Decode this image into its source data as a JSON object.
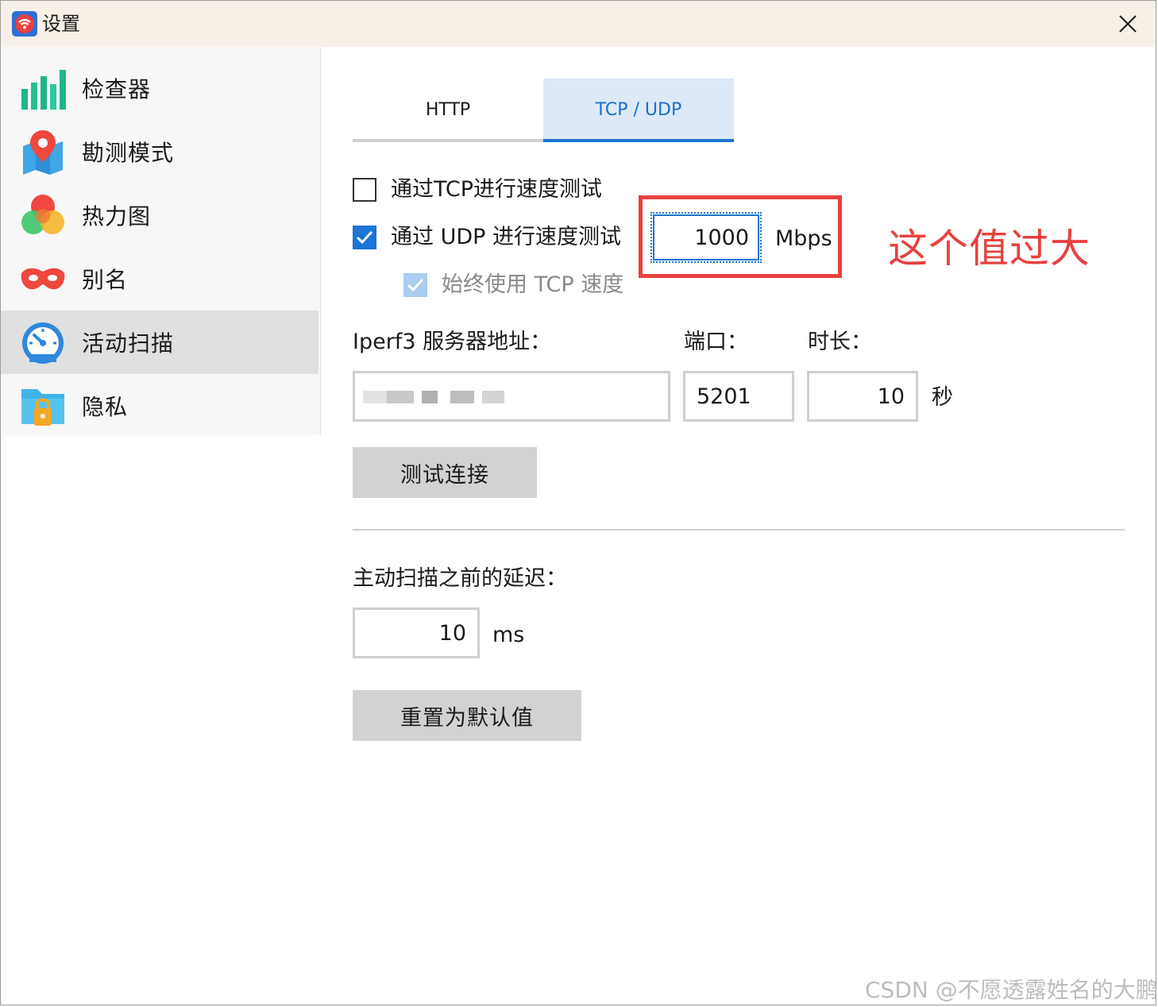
{
  "window": {
    "title": "设置"
  },
  "sidebar": {
    "items": [
      {
        "label": "检查器",
        "icon": "bar-chart-icon",
        "active": false
      },
      {
        "label": "勘测模式",
        "icon": "map-pin-icon",
        "active": false
      },
      {
        "label": "热力图",
        "icon": "heatmap-blob-icon",
        "active": false
      },
      {
        "label": "别名",
        "icon": "mask-icon",
        "active": false
      },
      {
        "label": "活动扫描",
        "icon": "speedometer-icon",
        "active": true
      },
      {
        "label": "隐私",
        "icon": "locked-folder-icon",
        "active": false
      }
    ]
  },
  "tabs": [
    {
      "label": "HTTP",
      "selected": false
    },
    {
      "label": "TCP / UDP",
      "selected": true
    }
  ],
  "tcp_udp": {
    "tcp_test_label": "通过TCP进行速度测试",
    "tcp_test_checked": false,
    "udp_test_label": "通过 UDP 进行速度测试",
    "udp_test_checked": true,
    "udp_rate_value": "1000",
    "udp_rate_unit": "Mbps",
    "always_tcp_label": "始终使用 TCP 速度",
    "always_tcp_checked": true,
    "server_label": "Iperf3 服务器地址：",
    "server_value": "",
    "port_label": "端口：",
    "port_value": "5201",
    "duration_label": "时长：",
    "duration_value": "10",
    "duration_unit": "秒",
    "test_button": "测试连接"
  },
  "delay": {
    "label": "主动扫描之前的延迟：",
    "value": "10",
    "unit": "ms"
  },
  "reset_button": "重置为默认值",
  "annotation": {
    "text": "这个值过大",
    "color": "#e8413f"
  },
  "watermark": "CSDN @不愿透露姓名的大鹏",
  "colors": {
    "accent": "#1c74d4",
    "tab_selected_bg": "#dde9f7",
    "titlebar_bg": "#f6f0e6"
  }
}
